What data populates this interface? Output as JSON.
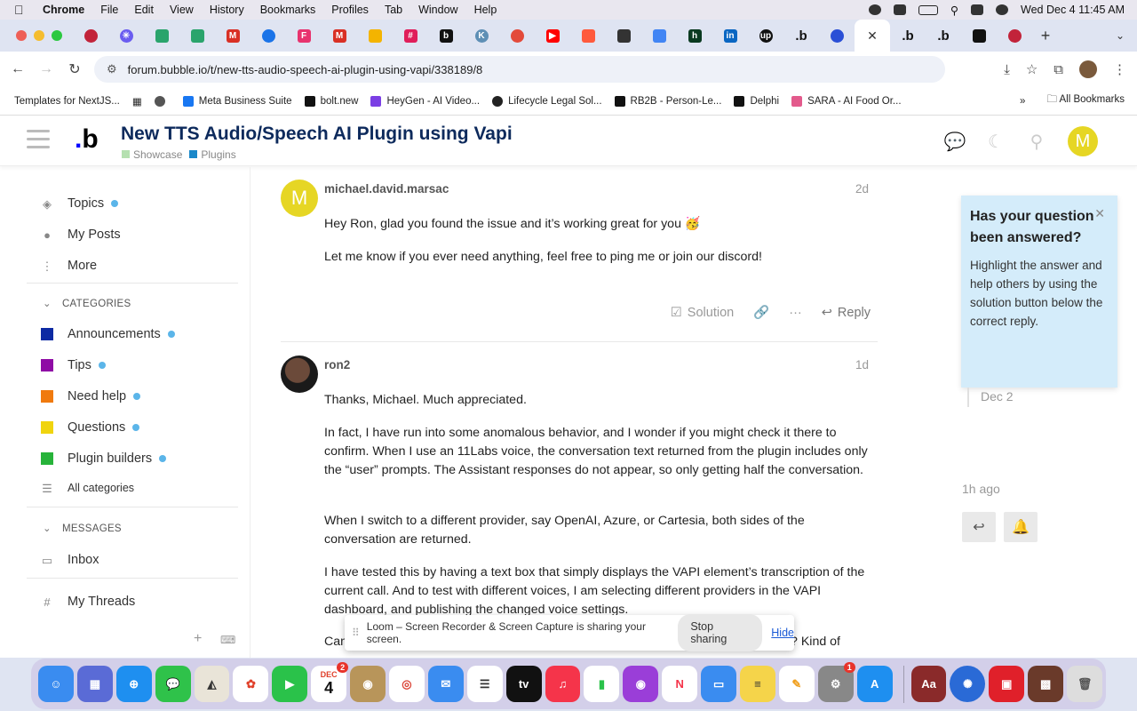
{
  "menubar": {
    "app": "Chrome",
    "items": [
      "File",
      "Edit",
      "View",
      "History",
      "Bookmarks",
      "Profiles",
      "Tab",
      "Window",
      "Help"
    ],
    "clock": "Wed Dec 4  11:45 AM"
  },
  "browser": {
    "url": "forum.bubble.io/t/new-tts-audio-speech-ai-plugin-using-vapi/338189/8",
    "bookmarks": [
      "Templates for NextJS...",
      "Meta Business Suite",
      "bolt.new",
      "HeyGen - AI Video...",
      "Lifecycle Legal Sol...",
      "RB2B - Person-Le...",
      "Delphi",
      "SARA - AI Food Or..."
    ],
    "all_bookmarks": "All Bookmarks"
  },
  "forum": {
    "title": "New TTS Audio/Speech AI Plugin using Vapi",
    "categories": [
      "Showcase",
      "Plugins"
    ],
    "user_initial": "M"
  },
  "sidebar": {
    "topics": "Topics",
    "my_posts": "My Posts",
    "more": "More",
    "categories_head": "CATEGORIES",
    "categories": [
      {
        "label": "Announcements",
        "color": "#0d2aa3"
      },
      {
        "label": "Tips",
        "color": "#8f0ba5"
      },
      {
        "label": "Need help",
        "color": "#f07a0e"
      },
      {
        "label": "Questions",
        "color": "#f0d40e"
      },
      {
        "label": "Plugin builders",
        "color": "#27b33a"
      }
    ],
    "all_categories": "All categories",
    "messages_head": "MESSAGES",
    "inbox": "Inbox",
    "my_threads": "My Threads"
  },
  "posts": [
    {
      "avatar": "M",
      "user": "michael.david.marsac",
      "age": "2d",
      "paragraphs": [
        "Hey Ron, glad you found the issue and it’s working great for you 🥳",
        "Let me know if you ever need anything, feel free to ping me or join our discord!"
      ],
      "solution_label": "Solution",
      "reply_label": "Reply"
    },
    {
      "user": "ron2",
      "age": "1d",
      "paragraphs": [
        "Thanks, Michael. Much appreciated.",
        "In fact, I have run into some anomalous behavior, and I wonder if you might check it there to confirm. When I use an 11Labs voice, the conversation text returned from the plugin includes only the “user” prompts. The Assistant responses do not appear, so only getting half the conversation.",
        "When I switch to a different provider, say OpenAI, Azure, or Cartesia, both sides of the conversation are returned.",
        "I have tested this by having a text box that simply displays the VAPI element’s transcription of the current call. And to test with different voices, I am selecting different providers in the VAPI dashboard, and publishing the changed voice settings."
      ],
      "partial_left": "Can",
      "partial_right": "? Kind of"
    }
  ],
  "aside": {
    "title": "Has your question been answered?",
    "body": "Highlight the answer and help others by using the solution button below the correct reply."
  },
  "timeline": {
    "top_date": "Dec 2",
    "bottom_date": "1h ago"
  },
  "loom": {
    "message": "Loom – Screen Recorder & Screen Capture is sharing your screen.",
    "stop_label": "Stop sharing",
    "hide_label": "Hide"
  },
  "dock": {
    "calendar_month": "DEC",
    "calendar_day": "4",
    "calendar_badge": "2",
    "settings_badge": "1",
    "dictionary_label": "Aa"
  }
}
